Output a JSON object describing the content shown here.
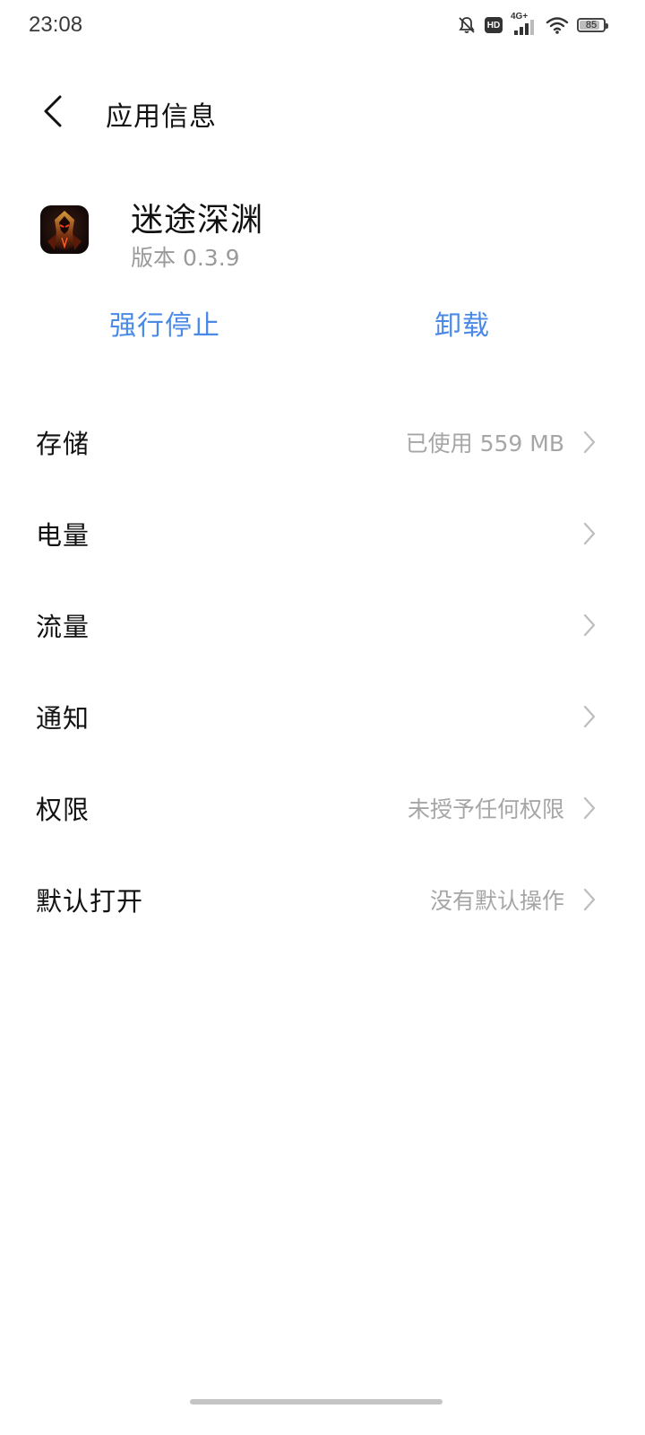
{
  "status_bar": {
    "time": "23:08",
    "network": "4G+",
    "hd_label": "HD",
    "battery_level": "85",
    "battery_fraction": 0.85,
    "icons": [
      "mute-notification-icon",
      "hd-icon",
      "cellular-signal-icon",
      "wifi-icon",
      "battery-icon"
    ]
  },
  "header": {
    "back_icon": "chevron-left-icon",
    "title": "应用信息"
  },
  "app": {
    "name": "迷途深渊",
    "version": "版本 0.3.9",
    "icon": "app-icon"
  },
  "actions": {
    "force_stop": "强行停止",
    "uninstall": "卸载",
    "accent_color": "#4a8ae6"
  },
  "settings": [
    {
      "label": "存储",
      "value": "已使用 559 MB"
    },
    {
      "label": "电量",
      "value": ""
    },
    {
      "label": "流量",
      "value": ""
    },
    {
      "label": "通知",
      "value": ""
    },
    {
      "label": "权限",
      "value": "未授予任何权限"
    },
    {
      "label": "默认打开",
      "value": "没有默认操作"
    }
  ]
}
